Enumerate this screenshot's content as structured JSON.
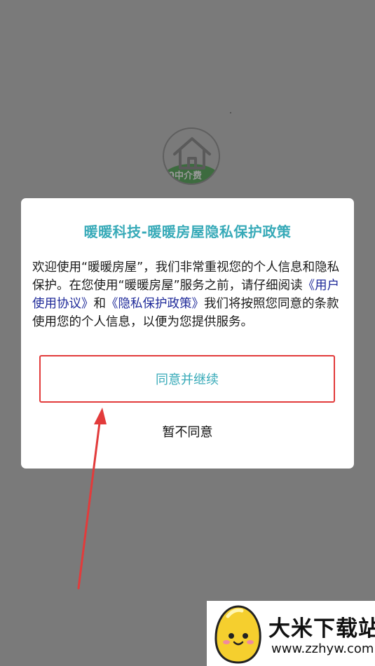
{
  "splash": {
    "logo_text": "0中介费"
  },
  "dialog": {
    "title": "暖暖科技-暖暖房屋隐私保护政策",
    "body_part1": "欢迎使用“暖暖房屋”，我们非常重视您的个人信息和隐私保护。在您使用“暖暖房屋”服务之前，请仔细阅读",
    "user_agreement_link": "《用户使用协议》",
    "body_and": "和",
    "privacy_policy_link": "《隐私保护政策》",
    "body_part2": "我们将按照您同意的条款使用您的个人信息，以便为您提供服务。",
    "agree_label": "同意并继续",
    "disagree_label": "暂不同意"
  },
  "watermark": {
    "title": "大米下载站",
    "url": "www.zzhyw.com"
  },
  "colors": {
    "overlay": "#7a7a7a",
    "accent": "#37aab8",
    "link": "#1f2a99",
    "highlight": "#e23b3b"
  }
}
